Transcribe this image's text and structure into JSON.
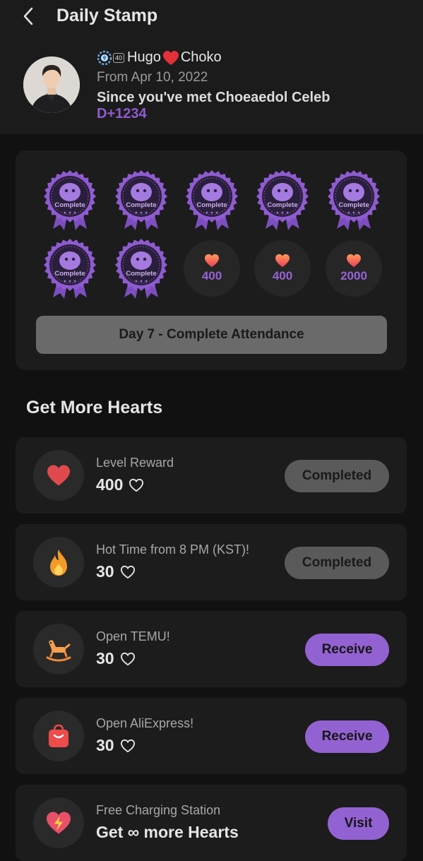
{
  "header": {
    "title": "Daily Stamp"
  },
  "profile": {
    "level": "40",
    "name_left": "Hugo",
    "name_right": "Choko",
    "from": "From Apr 10, 2022",
    "since": "Since you've met Choeaedol Celeb",
    "dday": "D+1234"
  },
  "stamps": {
    "complete_label": "Complete",
    "completed_days": 7,
    "remaining_rewards": [
      "400",
      "400",
      "2000"
    ],
    "button_label": "Day 7 - Complete Attendance"
  },
  "more_hearts": {
    "title": "Get More Hearts",
    "tasks": [
      {
        "label": "Level Reward",
        "reward": "400",
        "icon": "heart-icon",
        "button": "Completed",
        "state": "completed"
      },
      {
        "label": "Hot Time from 8 PM (KST)!",
        "reward": "30",
        "icon": "fire-icon",
        "button": "Completed",
        "state": "completed"
      },
      {
        "label": "Open TEMU!",
        "reward": "30",
        "icon": "rocking-horse-icon",
        "button": "Receive",
        "state": "receive"
      },
      {
        "label": "Open AliExpress!",
        "reward": "30",
        "icon": "shopping-bag-icon",
        "button": "Receive",
        "state": "receive"
      },
      {
        "label": "Free Charging Station",
        "reward": "Get ∞ more Hearts",
        "icon": "heart-bolt-icon",
        "button": "Visit",
        "state": "visit"
      }
    ]
  },
  "colors": {
    "accent": "#9362d2",
    "background": "#111111",
    "card": "#1c1c1c"
  }
}
